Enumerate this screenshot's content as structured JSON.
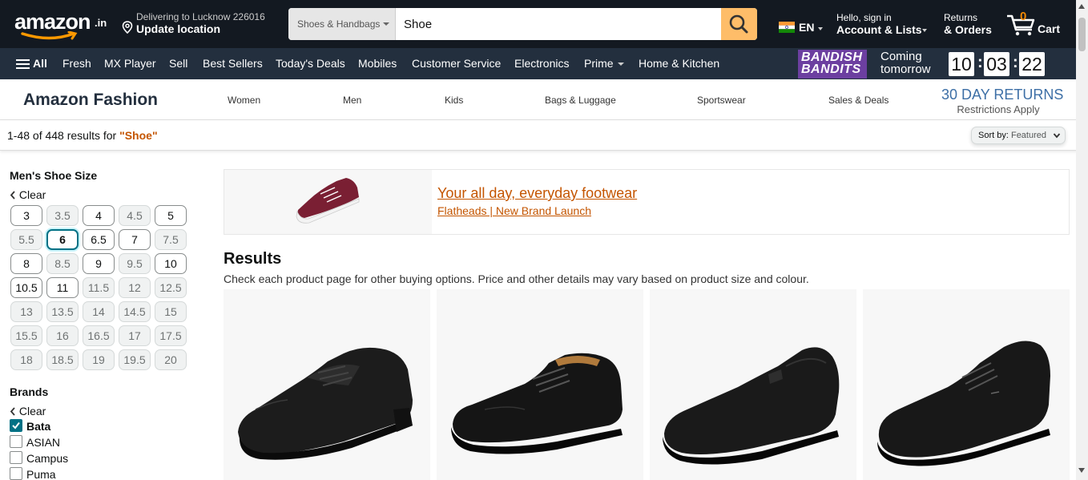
{
  "header": {
    "logo_text": "amazon",
    "logo_suffix": ".in",
    "deliver_line1": "Delivering to Lucknow 226016",
    "deliver_line2": "Update location",
    "search_category": "Shoes & Handbags",
    "search_value": "Shoe",
    "language": "EN",
    "account_line1": "Hello, sign in",
    "account_line2": "Account & Lists",
    "returns_line1": "Returns",
    "returns_line2": "& Orders",
    "cart_count": "0",
    "cart_label": "Cart"
  },
  "subnav": {
    "all_label": "All",
    "items": [
      "Fresh",
      "MX Player",
      "Sell",
      "Best Sellers",
      "Today's Deals",
      "Mobiles",
      "Customer Service",
      "Electronics",
      "Prime",
      "Home & Kitchen"
    ],
    "promo_brand_line1": "BANDISH",
    "promo_brand_line2": "BANDITS",
    "promo_line1": "Coming",
    "promo_line2": "tomorrow",
    "timer": [
      "10",
      "03",
      "22"
    ]
  },
  "fashion": {
    "title": "Amazon Fashion",
    "categories": [
      "Women",
      "Men",
      "Kids",
      "Bags & Luggage",
      "Sportswear",
      "Sales & Deals"
    ],
    "returns_title": "30 DAY RETURNS",
    "returns_sub": "Restrictions Apply"
  },
  "results_bar": {
    "count_text": "1-48 of 448 results for ",
    "query": "\"Shoe\"",
    "sort_label": "Sort by:",
    "sort_value": "Featured"
  },
  "sidebar": {
    "size_heading": "Men's Shoe Size",
    "clear_label": "Clear",
    "sizes": [
      "3",
      "3.5",
      "4",
      "4.5",
      "5",
      "5.5",
      "6",
      "6.5",
      "7",
      "7.5",
      "8",
      "8.5",
      "9",
      "9.5",
      "10",
      "10.5",
      "11",
      "11.5",
      "12",
      "12.5",
      "13",
      "13.5",
      "14",
      "14.5",
      "15",
      "15.5",
      "16",
      "16.5",
      "17",
      "17.5",
      "18",
      "18.5",
      "19",
      "19.5",
      "20"
    ],
    "selected_size": "6",
    "brands_heading": "Brands",
    "brands": [
      {
        "name": "Bata",
        "checked": true
      },
      {
        "name": "ASIAN",
        "checked": false
      },
      {
        "name": "Campus",
        "checked": false
      },
      {
        "name": "Puma",
        "checked": false
      }
    ]
  },
  "banner": {
    "headline": "Your all day, everyday footwear",
    "subline": "Flatheads | New Brand Launch"
  },
  "results": {
    "heading": "Results",
    "subheading": "Check each product page for other buying options. Price and other details may vary based on product size and colour."
  },
  "colors": {
    "nav_dark": "#131921",
    "nav_secondary": "#232f3e",
    "search_button": "#febd69",
    "link_orange": "#c45500",
    "selected_teal": "#007185"
  }
}
